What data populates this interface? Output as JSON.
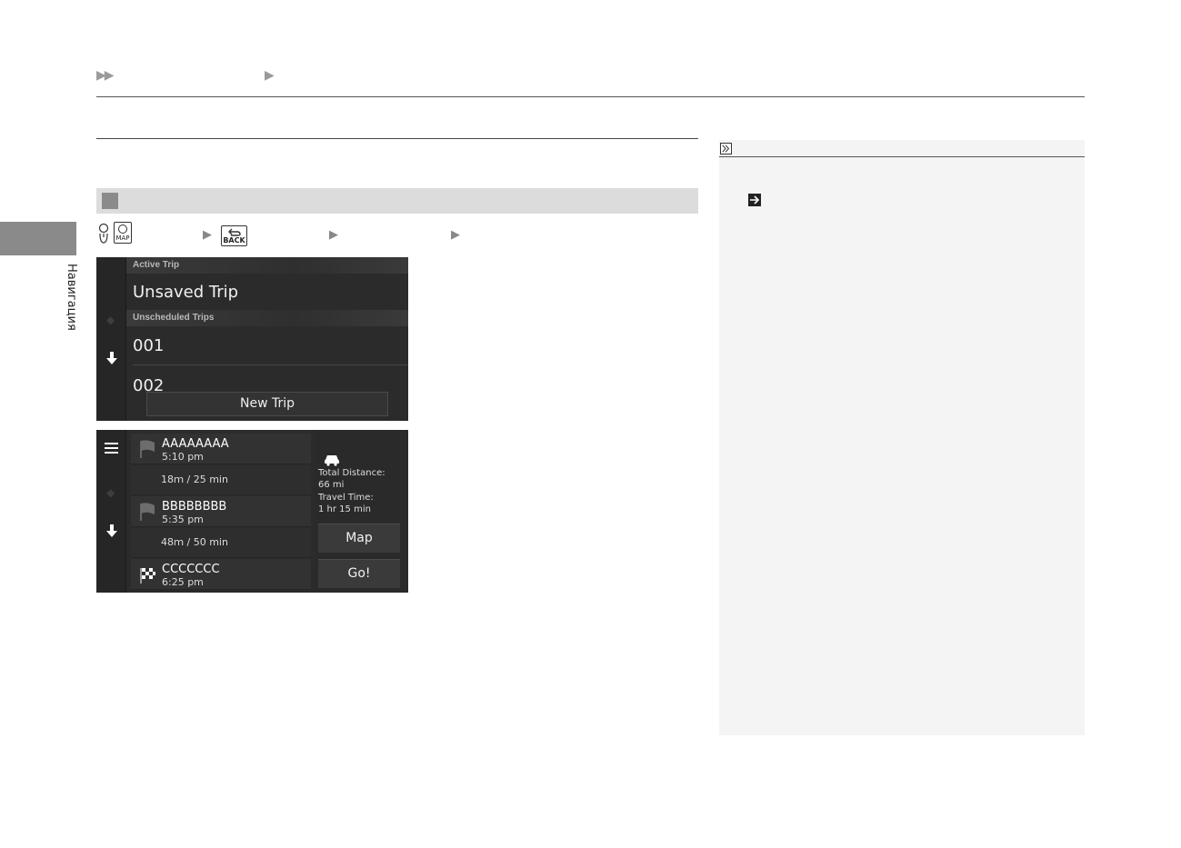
{
  "header": {
    "breadcrumb_arrows": "▶▶",
    "breadcrumb_sep": "▶"
  },
  "side_tab": {
    "label": "Навигация"
  },
  "steps": {
    "knob_icon": "dial-knob-icon",
    "map_button_label": "MAP",
    "back_button_label": "BACK",
    "sep": "▶"
  },
  "screen1": {
    "active_trip_header": "Active Trip",
    "active_trip_name": "Unsaved Trip",
    "unscheduled_header": "Unscheduled Trips",
    "trips": [
      "001",
      "002"
    ],
    "new_trip_button": "New Trip"
  },
  "screen2": {
    "stops": [
      {
        "name": "AAAAAAAA",
        "time": "5:10 pm",
        "icon": "flag-icon"
      },
      {
        "name": "BBBBBBBB",
        "time": "5:35 pm",
        "icon": "flag-icon"
      },
      {
        "name": "CCCCCCC",
        "time": "6:25 pm",
        "icon": "checkered-flag-icon"
      }
    ],
    "legs": [
      "18ｍ / 25 min",
      "48ｍ / 50 min"
    ],
    "total_distance_label": "Total Distance:",
    "total_distance_value": "66 mi",
    "travel_time_label": "Travel Time:",
    "travel_time_value": "1 hr 15 min",
    "map_button": "Map",
    "go_button": "Go!"
  },
  "colors": {
    "screen_bg": "#2b2b2b",
    "band_gray": "#dcdcdc",
    "note_bg": "#f4f4f4"
  }
}
